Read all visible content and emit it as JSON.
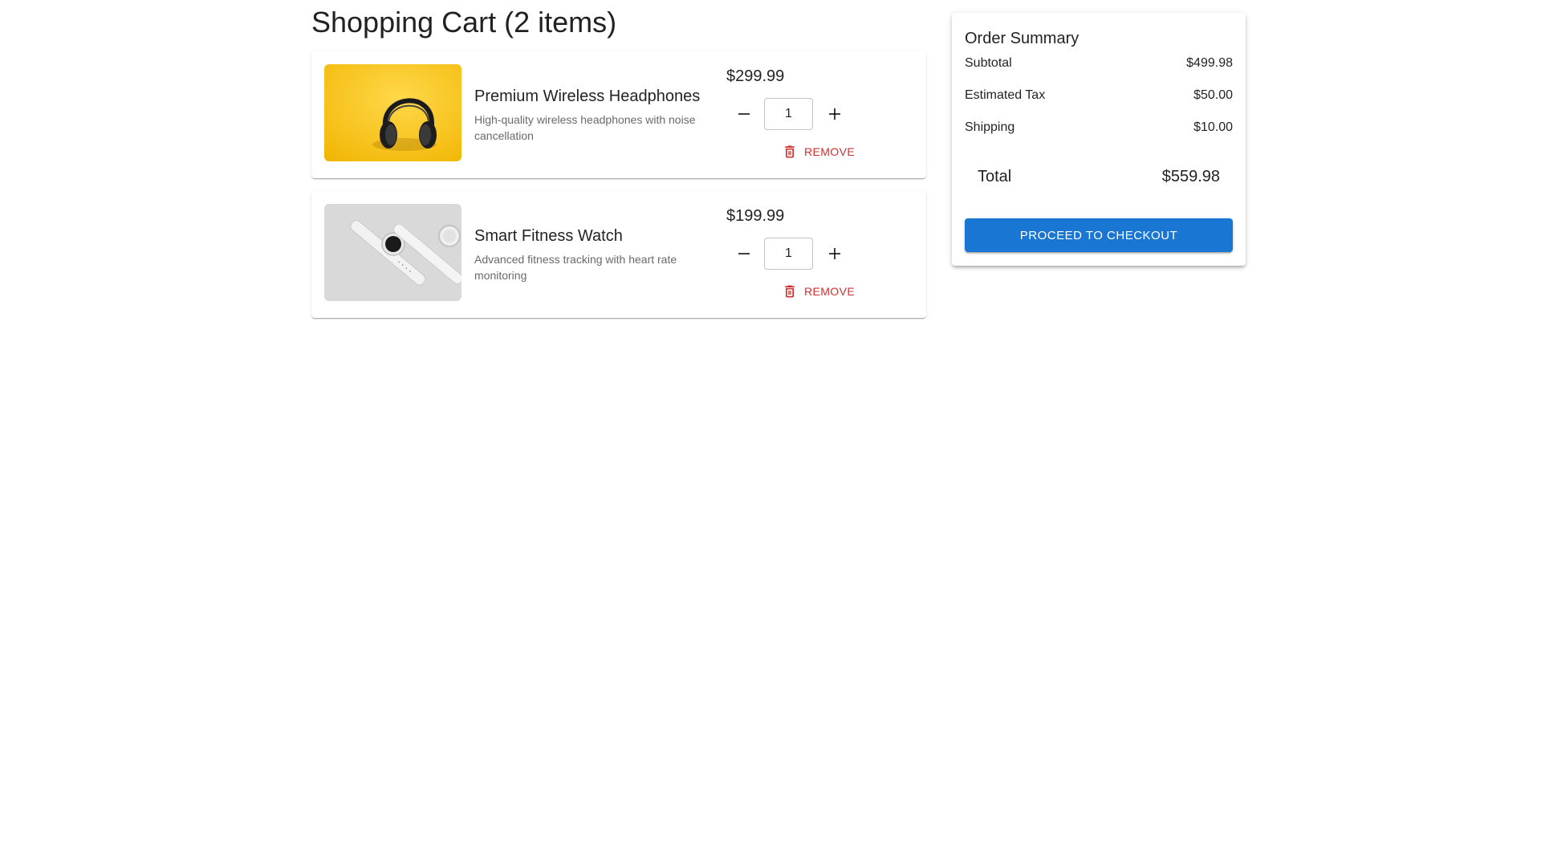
{
  "cart": {
    "title": "Shopping Cart (2 items)",
    "remove_label": "Remove",
    "items": [
      {
        "name": "Premium Wireless Headphones",
        "description": "High-quality wireless headphones with noise cancellation",
        "price": "$299.99",
        "quantity": "1",
        "image_icon": "headphones-photo"
      },
      {
        "name": "Smart Fitness Watch",
        "description": "Advanced fitness tracking with heart rate monitoring",
        "price": "$199.99",
        "quantity": "1",
        "image_icon": "smartwatch-photo"
      }
    ]
  },
  "summary": {
    "title": "Order Summary",
    "subtotal_label": "Subtotal",
    "subtotal_value": "$499.98",
    "tax_label": "Estimated Tax",
    "tax_value": "$50.00",
    "shipping_label": "Shipping",
    "shipping_value": "$10.00",
    "total_label": "Total",
    "total_value": "$559.98",
    "checkout_label": "Proceed to Checkout"
  },
  "colors": {
    "primary": "#1976d2",
    "danger": "#d32f2f",
    "headphones_bg": "#f5c518",
    "watch_bg": "#d9d9d9"
  }
}
